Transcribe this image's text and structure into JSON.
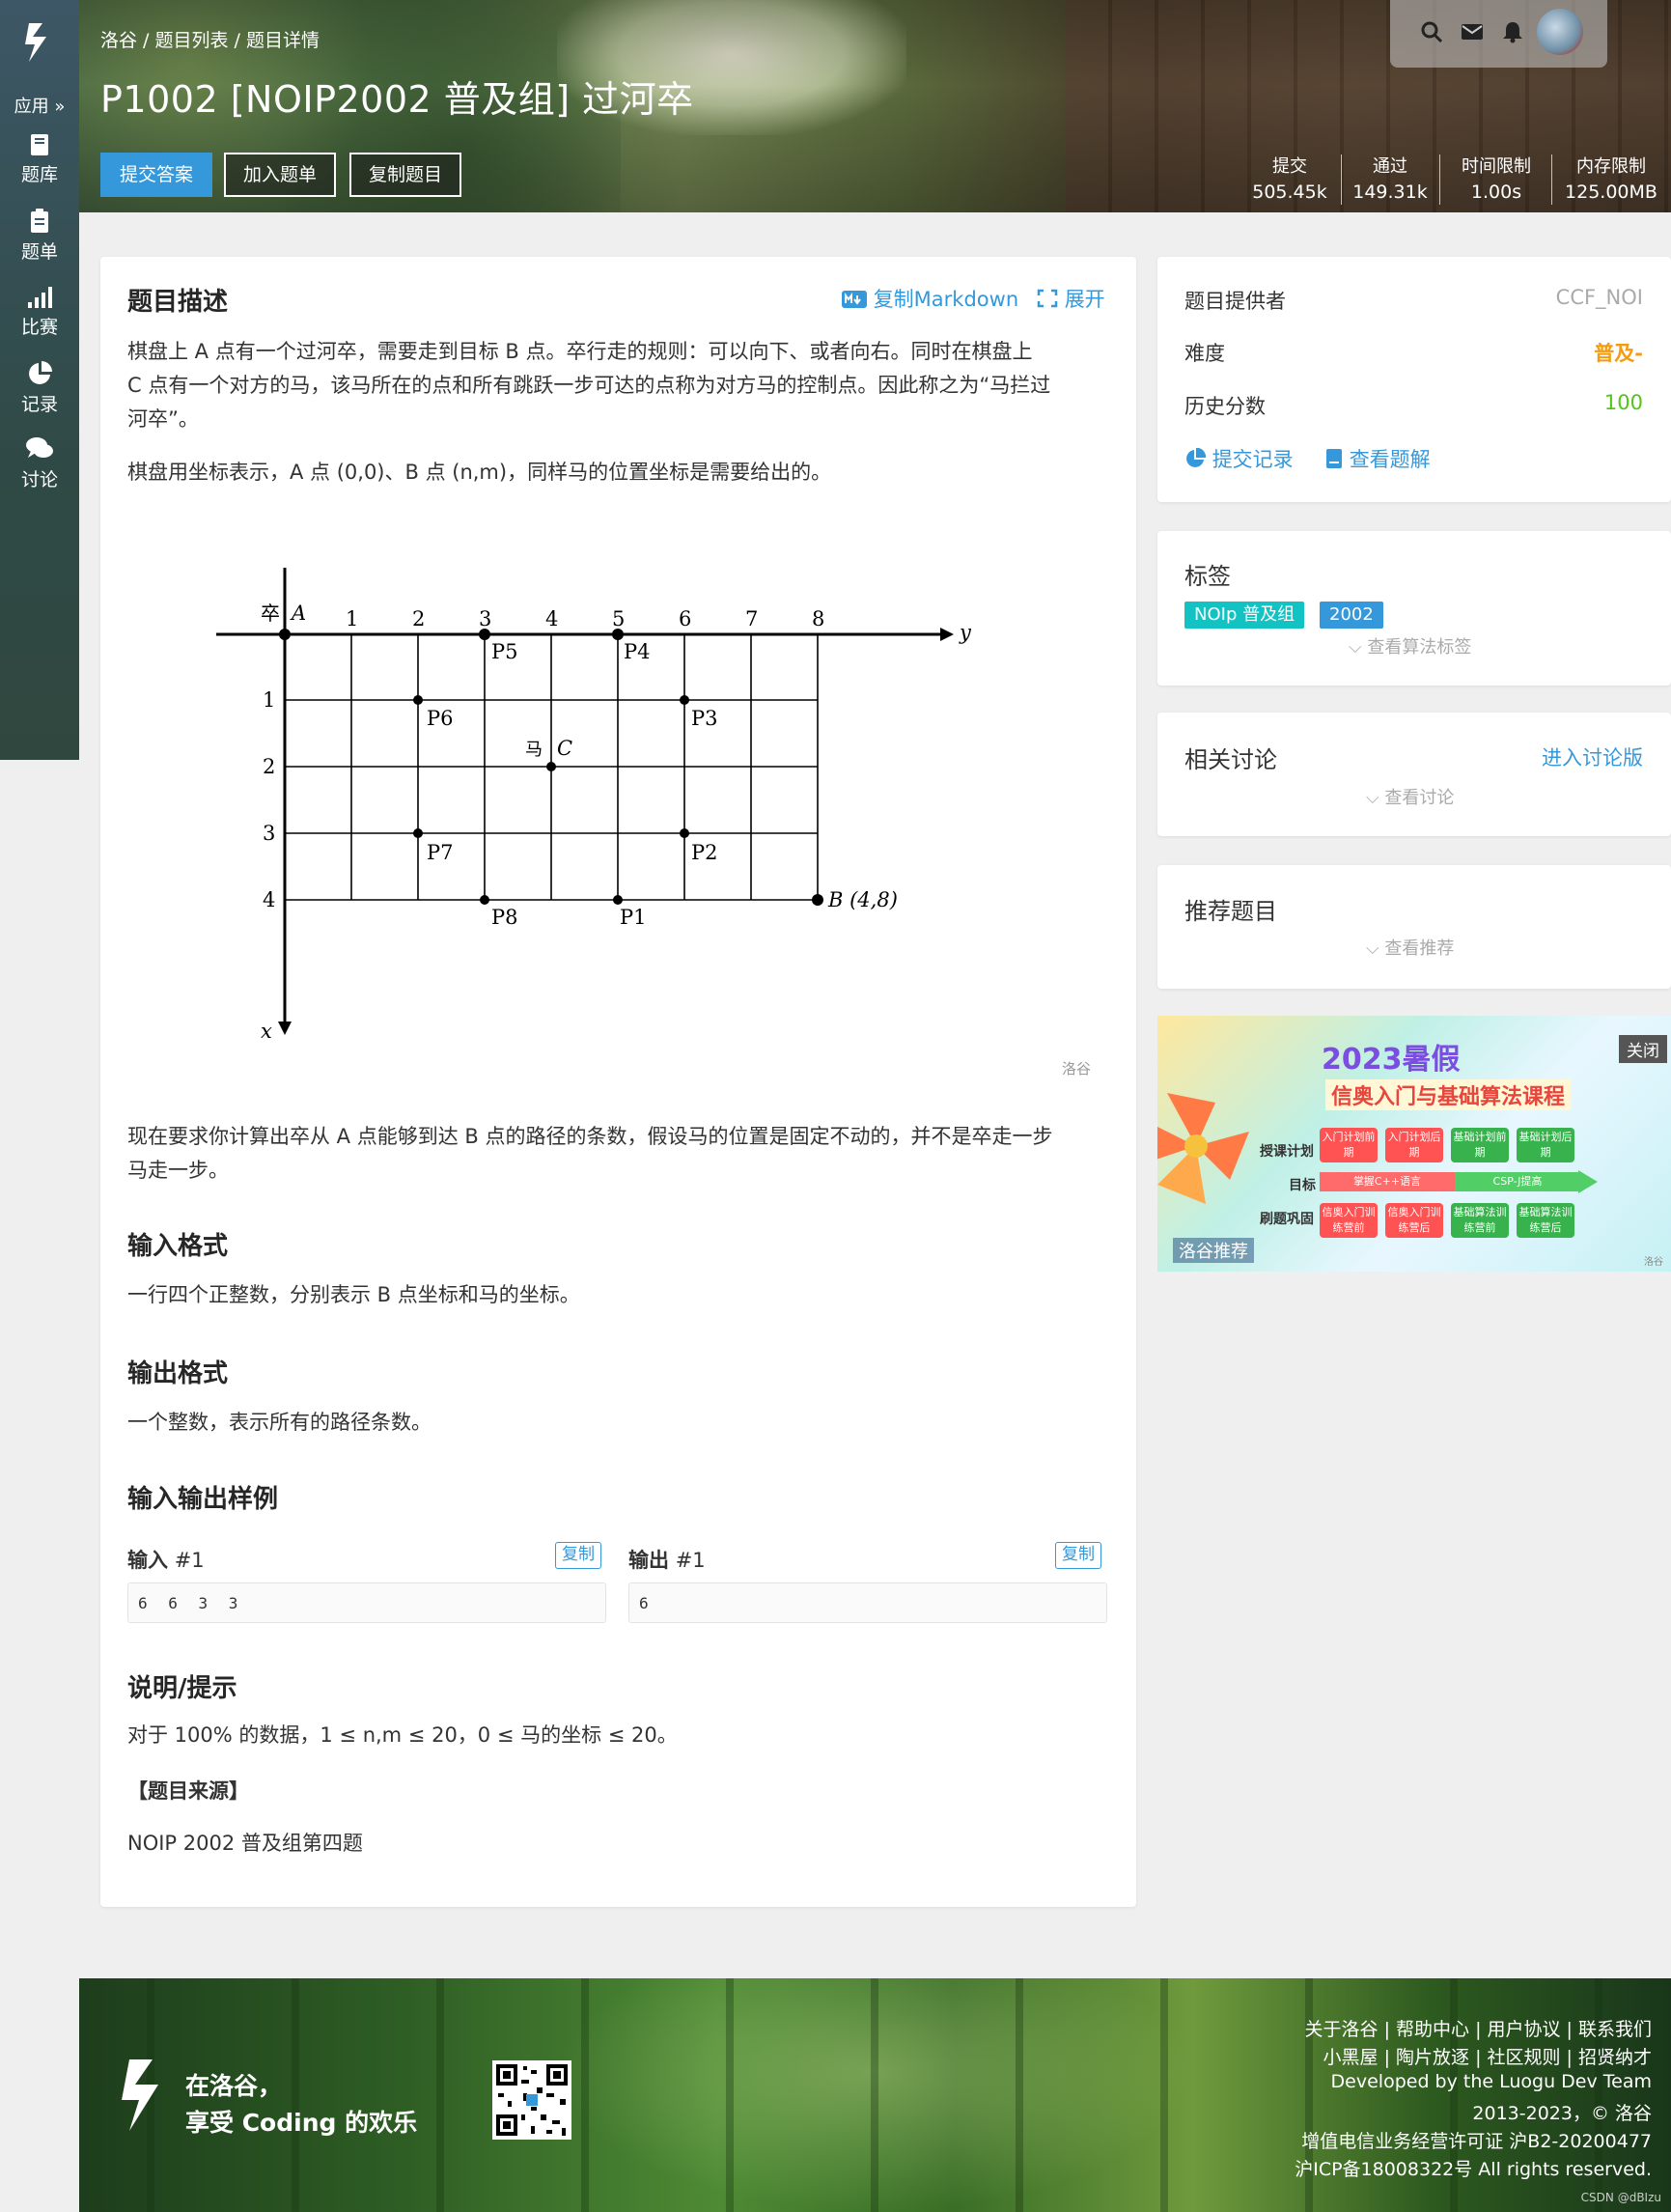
{
  "sidebar": {
    "apps_label": "应用 »",
    "items": [
      {
        "label": "题库",
        "icon": "book-icon"
      },
      {
        "label": "题单",
        "icon": "clipboard-icon"
      },
      {
        "label": "比赛",
        "icon": "bar-chart-icon"
      },
      {
        "label": "记录",
        "icon": "pie-chart-icon"
      },
      {
        "label": "讨论",
        "icon": "comments-icon"
      }
    ]
  },
  "header": {
    "breadcrumb": [
      "洛谷",
      "题目列表",
      "题目详情"
    ],
    "breadcrumb_sep": " / ",
    "title": "P1002 [NOIP2002 普及组] 过河卒",
    "buttons": {
      "submit": "提交答案",
      "add": "加入题单",
      "copy": "复制题目"
    },
    "stats": [
      {
        "label": "提交",
        "value": "505.45k"
      },
      {
        "label": "通过",
        "value": "149.31k"
      },
      {
        "label": "时间限制",
        "value": "1.00s"
      },
      {
        "label": "内存限制",
        "value": "125.00MB"
      }
    ]
  },
  "main": {
    "desc_title": "题目描述",
    "copy_markdown": "复制Markdown",
    "expand": "展开",
    "desc_p1": "棋盘上 A 点有一个过河卒，需要走到目标 B 点。卒行走的规则：可以向下、或者向右。同时在棋盘上 C 点有一个对方的马，该马所在的点和所有跳跃一步可达的点称为对方马的控制点。因此称之为“马拦过河卒”。",
    "desc_p1_lines": [
      "棋盘上 A 点有一个过河卒，需要走到目标 B 点。卒行走的规则：可以向下、或者向右。同时在棋盘上",
      "C 点有一个对方的马，该马所在的点和所有跳跃一步可达的点称为对方马的控制点。因此称之为“马拦过",
      "河卒”。"
    ],
    "desc_p2": "棋盘用坐标表示，A 点 (0,0)、B 点 (n,m)，同样马的位置坐标是需要给出的。",
    "figure": {
      "col_labels": [
        "1",
        "2",
        "3",
        "4",
        "5",
        "6",
        "7",
        "8"
      ],
      "row_labels": [
        "1",
        "2",
        "3",
        "4"
      ],
      "zu": "卒",
      "A": "A",
      "y": "y",
      "x": "x",
      "ma": "马",
      "C": "C",
      "B": "B (4,8)",
      "points": [
        "P1",
        "P2",
        "P3",
        "P4",
        "P5",
        "P6",
        "P7",
        "P8"
      ],
      "watermark": "洛谷"
    },
    "desc_p3_lines": [
      "现在要求你计算出卒从 A 点能够到达 B 点的路径的条数，假设马的位置是固定不动的，并不是卒走一步",
      "马走一步。"
    ],
    "input_title": "输入格式",
    "input_text": "一行四个正整数，分别表示 B 点坐标和马的坐标。",
    "output_title": "输出格式",
    "output_text": "一个整数，表示所有的路径条数。",
    "sample_title": "输入输出样例",
    "sample_in_label": "输入",
    "sample_out_label": "输出",
    "sample_index": "#1",
    "copy_label": "复制",
    "sample_in": "6 6 3 3",
    "sample_out": "6",
    "hint_title": "说明/提示",
    "hint_text": "对于 100% 的数据，1 ≤ n,m ≤ 20，0 ≤ 马的坐标 ≤ 20。",
    "source_title": "【题目来源】",
    "source_text": "NOIP 2002 普及组第四题"
  },
  "side": {
    "provider_label": "题目提供者",
    "provider_value": "CCF_NOI",
    "difficulty_label": "难度",
    "difficulty_value": "普及-",
    "score_label": "历史分数",
    "score_value": "100",
    "records_link": "提交记录",
    "solution_link": "查看题解",
    "tags_title": "标签",
    "tags": [
      "NOIp 普及组",
      "2002"
    ],
    "tags_more": "查看算法标签",
    "discuss_title": "相关讨论",
    "discuss_link": "进入讨论版",
    "discuss_more": "查看讨论",
    "recommend_title": "推荐题目",
    "recommend_more": "查看推荐"
  },
  "ad": {
    "title": "2023暑假",
    "subtitle": "信奥入门与基础算法课程",
    "close": "关闭",
    "plan_label": "授课计划",
    "goal_label": "目标",
    "review_label": "刷题巩固",
    "plans": [
      "入门计划前期",
      "入门计划后期",
      "基础计划前期",
      "基础计划后期"
    ],
    "goal_left": "掌握C++语言",
    "goal_right": "CSP-J提高",
    "reviews": [
      "信奥入门训练营前",
      "信奥入门训练营后",
      "基础算法训练营前",
      "基础算法训练营后"
    ],
    "badge": "洛谷推荐",
    "corner": "洛谷"
  },
  "footer": {
    "slogan1": "在洛谷，",
    "slogan2": "享受 Coding 的欢乐",
    "links1": "关于洛谷 | 帮助中心 | 用户协议 | 联系我们",
    "links2": "小黑屋 | 陶片放逐 | 社区规则 | 招贤纳才",
    "dev": "Developed by the Luogu Dev Team",
    "copyright": "2013-2023，© 洛谷",
    "license": "增值电信业务经营许可证 沪B2-20200477",
    "icp": "沪ICP备18008322号 All rights reserved.",
    "csdn": "CSDN @dBIzu"
  },
  "colors": {
    "accent": "#3498db",
    "difficulty": "#f39c11",
    "score": "#52c41a",
    "tag_green": "#13c2c2",
    "tag_blue": "#3498db"
  }
}
